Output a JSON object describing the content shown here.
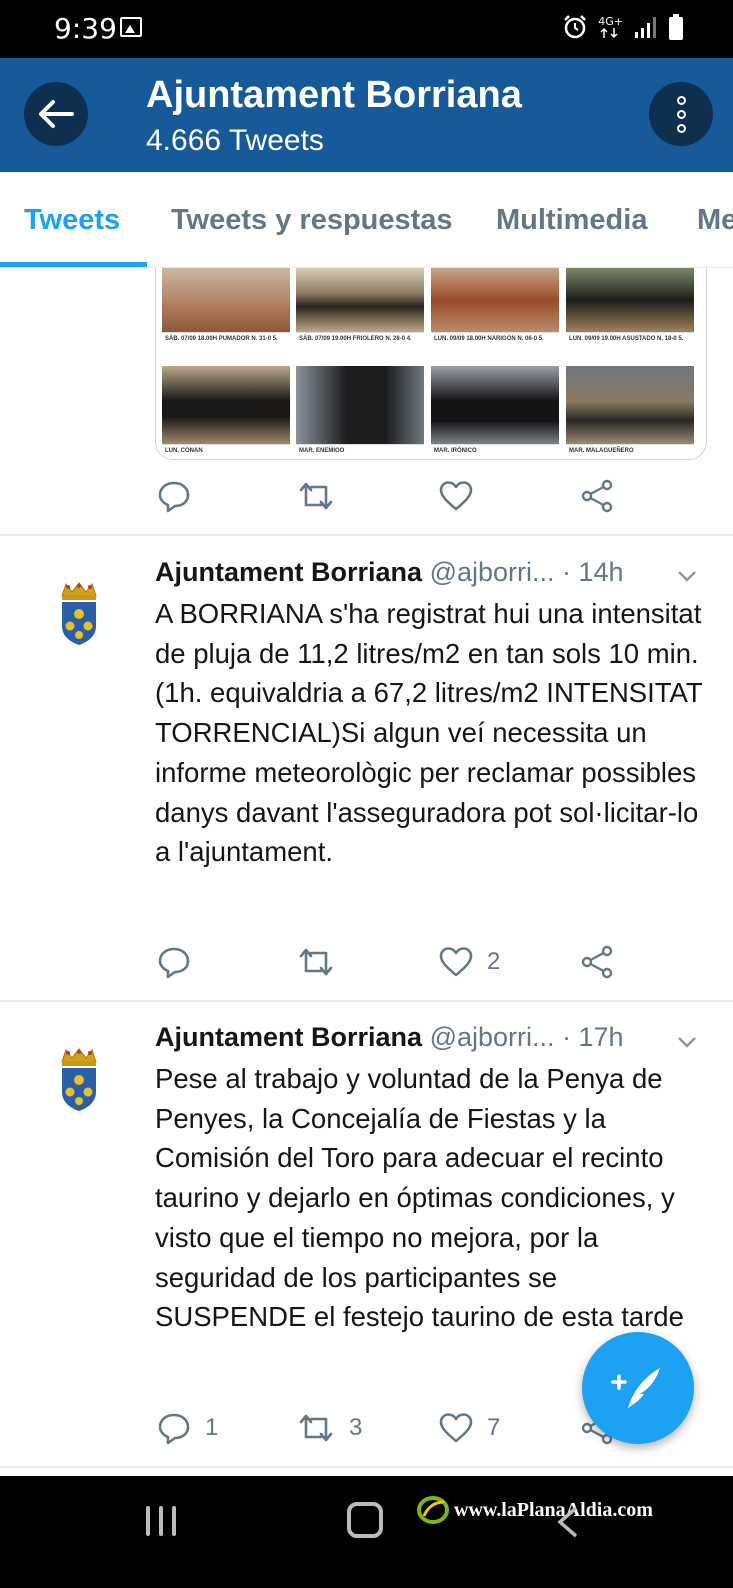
{
  "status_bar": {
    "time": "9:39",
    "network": "4G+"
  },
  "header": {
    "title": "Ajuntament Borriana",
    "subtitle": "4.666 Tweets"
  },
  "tabs": [
    {
      "label": "Tweets",
      "active": true
    },
    {
      "label": "Tweets y respuestas",
      "active": false
    },
    {
      "label": "Multimedia",
      "active": false
    },
    {
      "label": "Me",
      "active": false
    }
  ],
  "media_preview": {
    "cells": [
      {
        "day": "SÀB. 07/09 18.00H",
        "name": "PUMADOR N. 31-0 5."
      },
      {
        "day": "SÀB. 07/09 19.00H",
        "name": "FRIOLERO N. 28-0 4."
      },
      {
        "day": "LUN. 09/09 18.00H",
        "name": "NARIGÓN N. 06-0 5."
      },
      {
        "day": "LUN. 09/09 19.00H",
        "name": "ASUSTADO N. 18-0 5."
      },
      {
        "day": "LUN.",
        "name": "CONAN"
      },
      {
        "day": "MAR.",
        "name": "ENEMIGO"
      },
      {
        "day": "MAR.",
        "name": "IRÓNICO"
      },
      {
        "day": "MAR.",
        "name": "MALAGUEÑERO"
      }
    ],
    "photo_colors": [
      "#b07a5a",
      "#8c7a5e",
      "#9a6a4a",
      "#6b7a5a",
      "#a08a6a",
      "#5f6a70",
      "#8a8f95",
      "#8a7a62"
    ]
  },
  "prev_tweet_actions": {
    "reply": "",
    "retweet": "",
    "like": ""
  },
  "tweets": [
    {
      "name": "Ajuntament Borriana",
      "handle": "@ajborri...",
      "time": "· 14h",
      "text": "A BORRIANA s'ha registrat hui una intensitat de pluja de 11,2 litres/m2 en tan sols 10 min. (1h. equivaldria a 67,2 litres/m2 INTENSITAT TORRENCIAL)Si algun veí necessita un informe meteorològic per reclamar possibles danys davant l'asseguradora pot sol·licitar-lo a l'ajuntament.",
      "reply_count": "",
      "retweet_count": "",
      "like_count": "2"
    },
    {
      "name": "Ajuntament Borriana",
      "handle": "@ajborri...",
      "time": "· 17h",
      "text": "Pese al trabajo y voluntad de la Penya de Penyes, la Concejalía de Fiestas y la Comisión del Toro para adecuar el recinto taurino y dejarlo en óptimas condiciones, y visto que el tiempo no mejora, por la seguridad de los participantes se  SUSPENDE el festejo taurino de esta tarde",
      "reply_count": "1",
      "retweet_count": "3",
      "like_count": "7"
    }
  ],
  "watermark": "www.laPlanaAldia.com",
  "colors": {
    "header_bg": "#175a9a",
    "accent": "#1da1f2",
    "muted": "#657786"
  }
}
